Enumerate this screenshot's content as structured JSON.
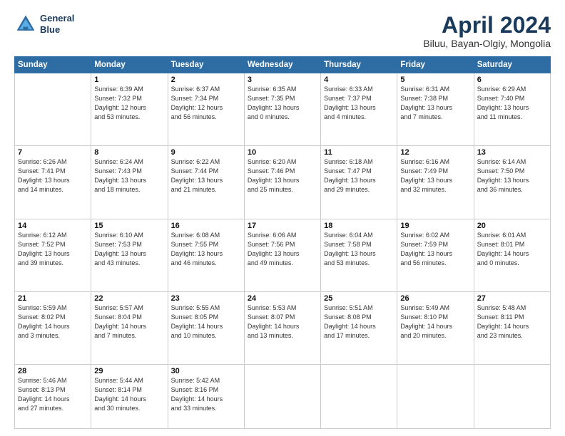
{
  "header": {
    "logo_line1": "General",
    "logo_line2": "Blue",
    "month": "April 2024",
    "location": "Biluu, Bayan-Olgiy, Mongolia"
  },
  "weekdays": [
    "Sunday",
    "Monday",
    "Tuesday",
    "Wednesday",
    "Thursday",
    "Friday",
    "Saturday"
  ],
  "weeks": [
    [
      {
        "day": "",
        "info": ""
      },
      {
        "day": "1",
        "info": "Sunrise: 6:39 AM\nSunset: 7:32 PM\nDaylight: 12 hours\nand 53 minutes."
      },
      {
        "day": "2",
        "info": "Sunrise: 6:37 AM\nSunset: 7:34 PM\nDaylight: 12 hours\nand 56 minutes."
      },
      {
        "day": "3",
        "info": "Sunrise: 6:35 AM\nSunset: 7:35 PM\nDaylight: 13 hours\nand 0 minutes."
      },
      {
        "day": "4",
        "info": "Sunrise: 6:33 AM\nSunset: 7:37 PM\nDaylight: 13 hours\nand 4 minutes."
      },
      {
        "day": "5",
        "info": "Sunrise: 6:31 AM\nSunset: 7:38 PM\nDaylight: 13 hours\nand 7 minutes."
      },
      {
        "day": "6",
        "info": "Sunrise: 6:29 AM\nSunset: 7:40 PM\nDaylight: 13 hours\nand 11 minutes."
      }
    ],
    [
      {
        "day": "7",
        "info": "Sunrise: 6:26 AM\nSunset: 7:41 PM\nDaylight: 13 hours\nand 14 minutes."
      },
      {
        "day": "8",
        "info": "Sunrise: 6:24 AM\nSunset: 7:43 PM\nDaylight: 13 hours\nand 18 minutes."
      },
      {
        "day": "9",
        "info": "Sunrise: 6:22 AM\nSunset: 7:44 PM\nDaylight: 13 hours\nand 21 minutes."
      },
      {
        "day": "10",
        "info": "Sunrise: 6:20 AM\nSunset: 7:46 PM\nDaylight: 13 hours\nand 25 minutes."
      },
      {
        "day": "11",
        "info": "Sunrise: 6:18 AM\nSunset: 7:47 PM\nDaylight: 13 hours\nand 29 minutes."
      },
      {
        "day": "12",
        "info": "Sunrise: 6:16 AM\nSunset: 7:49 PM\nDaylight: 13 hours\nand 32 minutes."
      },
      {
        "day": "13",
        "info": "Sunrise: 6:14 AM\nSunset: 7:50 PM\nDaylight: 13 hours\nand 36 minutes."
      }
    ],
    [
      {
        "day": "14",
        "info": "Sunrise: 6:12 AM\nSunset: 7:52 PM\nDaylight: 13 hours\nand 39 minutes."
      },
      {
        "day": "15",
        "info": "Sunrise: 6:10 AM\nSunset: 7:53 PM\nDaylight: 13 hours\nand 43 minutes."
      },
      {
        "day": "16",
        "info": "Sunrise: 6:08 AM\nSunset: 7:55 PM\nDaylight: 13 hours\nand 46 minutes."
      },
      {
        "day": "17",
        "info": "Sunrise: 6:06 AM\nSunset: 7:56 PM\nDaylight: 13 hours\nand 49 minutes."
      },
      {
        "day": "18",
        "info": "Sunrise: 6:04 AM\nSunset: 7:58 PM\nDaylight: 13 hours\nand 53 minutes."
      },
      {
        "day": "19",
        "info": "Sunrise: 6:02 AM\nSunset: 7:59 PM\nDaylight: 13 hours\nand 56 minutes."
      },
      {
        "day": "20",
        "info": "Sunrise: 6:01 AM\nSunset: 8:01 PM\nDaylight: 14 hours\nand 0 minutes."
      }
    ],
    [
      {
        "day": "21",
        "info": "Sunrise: 5:59 AM\nSunset: 8:02 PM\nDaylight: 14 hours\nand 3 minutes."
      },
      {
        "day": "22",
        "info": "Sunrise: 5:57 AM\nSunset: 8:04 PM\nDaylight: 14 hours\nand 7 minutes."
      },
      {
        "day": "23",
        "info": "Sunrise: 5:55 AM\nSunset: 8:05 PM\nDaylight: 14 hours\nand 10 minutes."
      },
      {
        "day": "24",
        "info": "Sunrise: 5:53 AM\nSunset: 8:07 PM\nDaylight: 14 hours\nand 13 minutes."
      },
      {
        "day": "25",
        "info": "Sunrise: 5:51 AM\nSunset: 8:08 PM\nDaylight: 14 hours\nand 17 minutes."
      },
      {
        "day": "26",
        "info": "Sunrise: 5:49 AM\nSunset: 8:10 PM\nDaylight: 14 hours\nand 20 minutes."
      },
      {
        "day": "27",
        "info": "Sunrise: 5:48 AM\nSunset: 8:11 PM\nDaylight: 14 hours\nand 23 minutes."
      }
    ],
    [
      {
        "day": "28",
        "info": "Sunrise: 5:46 AM\nSunset: 8:13 PM\nDaylight: 14 hours\nand 27 minutes."
      },
      {
        "day": "29",
        "info": "Sunrise: 5:44 AM\nSunset: 8:14 PM\nDaylight: 14 hours\nand 30 minutes."
      },
      {
        "day": "30",
        "info": "Sunrise: 5:42 AM\nSunset: 8:16 PM\nDaylight: 14 hours\nand 33 minutes."
      },
      {
        "day": "",
        "info": ""
      },
      {
        "day": "",
        "info": ""
      },
      {
        "day": "",
        "info": ""
      },
      {
        "day": "",
        "info": ""
      }
    ]
  ]
}
